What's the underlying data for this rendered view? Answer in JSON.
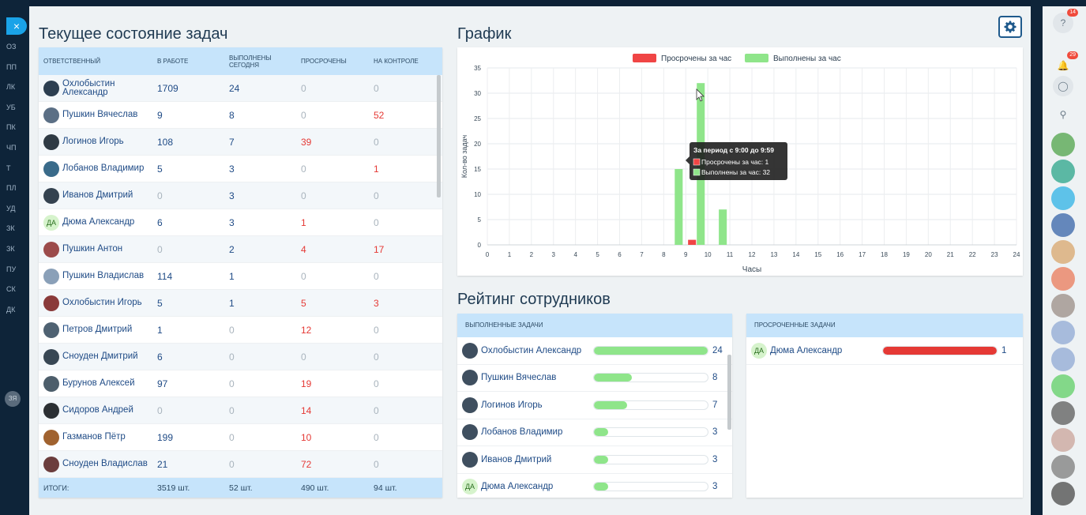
{
  "left_nav": {
    "close_symbol": "×",
    "items": [
      "ОЗ",
      "ПП",
      "ЛК",
      "УБ",
      "ПК",
      "ЧП",
      "Т",
      "ПЛ",
      "УД",
      "ЗК",
      "ЗК",
      "ПУ",
      "СК",
      "ДК"
    ],
    "user_initials": "ЗЯ"
  },
  "right_bar": {
    "help_badge": "14",
    "notifications_badge": "29"
  },
  "tasks": {
    "title": "Текущее состояние задач",
    "headers": [
      "ОТВЕТСТВЕННЫЙ",
      "В РАБОТЕ",
      "ВЫПОЛНЕНЫ СЕГОДНЯ",
      "ПРОСРОЧЕНЫ",
      "НА КОНТРОЛЕ"
    ],
    "rows": [
      {
        "name": "Охлобыстин Александр",
        "initials": "",
        "in_work": "1709",
        "done_today": "24",
        "overdue": "0",
        "control": "0"
      },
      {
        "name": "Пушкин Вячеслав",
        "initials": "",
        "in_work": "9",
        "done_today": "8",
        "overdue": "0",
        "control": "52"
      },
      {
        "name": "Логинов Игорь",
        "initials": "",
        "in_work": "108",
        "done_today": "7",
        "overdue": "39",
        "control": "0"
      },
      {
        "name": "Лобанов Владимир",
        "initials": "",
        "in_work": "5",
        "done_today": "3",
        "overdue": "0",
        "control": "1"
      },
      {
        "name": "Иванов Дмитрий",
        "initials": "",
        "in_work": "0",
        "done_today": "3",
        "overdue": "0",
        "control": "0"
      },
      {
        "name": "Дюма Александр",
        "initials": "ДА",
        "in_work": "6",
        "done_today": "3",
        "overdue": "1",
        "control": "0"
      },
      {
        "name": "Пушкин Антон",
        "initials": "",
        "in_work": "0",
        "done_today": "2",
        "overdue": "4",
        "control": "17"
      },
      {
        "name": "Пушкин Владислав",
        "initials": "",
        "in_work": "114",
        "done_today": "1",
        "overdue": "0",
        "control": "0"
      },
      {
        "name": "Охлобыстин Игорь",
        "initials": "",
        "in_work": "5",
        "done_today": "1",
        "overdue": "5",
        "control": "3"
      },
      {
        "name": "Петров Дмитрий",
        "initials": "",
        "in_work": "1",
        "done_today": "0",
        "overdue": "12",
        "control": "0"
      },
      {
        "name": "Сноуден Дмитрий",
        "initials": "",
        "in_work": "6",
        "done_today": "0",
        "overdue": "0",
        "control": "0"
      },
      {
        "name": "Бурунов Алексей",
        "initials": "",
        "in_work": "97",
        "done_today": "0",
        "overdue": "19",
        "control": "0"
      },
      {
        "name": "Сидоров Андрей",
        "initials": "",
        "in_work": "0",
        "done_today": "0",
        "overdue": "14",
        "control": "0"
      },
      {
        "name": "Газманов Пётр",
        "initials": "",
        "in_work": "199",
        "done_today": "0",
        "overdue": "10",
        "control": "0"
      },
      {
        "name": "Сноуден Владислав",
        "initials": "",
        "in_work": "21",
        "done_today": "0",
        "overdue": "72",
        "control": "0"
      }
    ],
    "totals": {
      "label": "ИТОГИ:",
      "in_work": "3519 шт.",
      "done_today": "52 шт.",
      "overdue": "490 шт.",
      "control": "94 шт."
    }
  },
  "chart_section": {
    "title": "График"
  },
  "chart_data": {
    "type": "bar",
    "title": "",
    "xlabel": "Часы",
    "ylabel": "Кол-во задач",
    "x": [
      0,
      1,
      2,
      3,
      4,
      5,
      6,
      7,
      8,
      9,
      10,
      11,
      12,
      13,
      14,
      15,
      16,
      17,
      18,
      19,
      20,
      21,
      22,
      23,
      24
    ],
    "ylim": [
      0,
      35
    ],
    "yticks": [
      0,
      5,
      10,
      15,
      20,
      25,
      30,
      35
    ],
    "grid": true,
    "legend_position": "top",
    "series": [
      {
        "name": "Просрочены за час",
        "color": "#f04545",
        "values": [
          0,
          0,
          0,
          0,
          0,
          0,
          0,
          0,
          0,
          1,
          0,
          0,
          0,
          0,
          0,
          0,
          0,
          0,
          0,
          0,
          0,
          0,
          0,
          0
        ]
      },
      {
        "name": "Выполнены за час",
        "color": "#8fe58a",
        "values": [
          0,
          0,
          0,
          0,
          0,
          0,
          0,
          0,
          15,
          32,
          7,
          0,
          0,
          0,
          0,
          0,
          0,
          0,
          0,
          0,
          0,
          0,
          0,
          0
        ]
      }
    ],
    "tooltip": {
      "title": "За период с 9:00 до 9:59",
      "lines": [
        "Просрочены за час: 1",
        "Выполнены за час: 32"
      ]
    }
  },
  "rating": {
    "title": "Рейтинг сотрудников",
    "completed": {
      "header": "ВЫПОЛНЕННЫЕ ЗАДАЧИ",
      "color": "#8fe58a",
      "max": 24,
      "rows": [
        {
          "name": "Охлобыстин Александр",
          "initials": "",
          "value": 24
        },
        {
          "name": "Пушкин Вячеслав",
          "initials": "",
          "value": 8
        },
        {
          "name": "Логинов Игорь",
          "initials": "",
          "value": 7
        },
        {
          "name": "Лобанов Владимир",
          "initials": "",
          "value": 3
        },
        {
          "name": "Иванов Дмитрий",
          "initials": "",
          "value": 3
        },
        {
          "name": "Дюма Александр",
          "initials": "ДА",
          "value": 3
        }
      ]
    },
    "overdue": {
      "header": "ПРОСРОЧЕННЫЕ ЗАДАЧИ",
      "color": "#e53935",
      "max": 1,
      "rows": [
        {
          "name": "Дюма Александр",
          "initials": "ДА",
          "value": 1
        }
      ]
    }
  }
}
